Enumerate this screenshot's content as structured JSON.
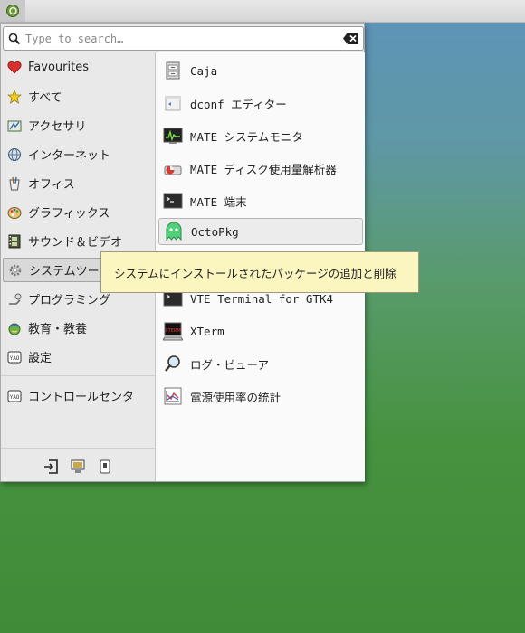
{
  "search": {
    "placeholder": "Type to search…"
  },
  "categories": [
    {
      "label": "Favourites",
      "icon": "heart-icon"
    },
    {
      "label": "すべて",
      "icon": "star-icon"
    },
    {
      "label": "アクセサリ",
      "icon": "accessories-icon"
    },
    {
      "label": "インターネット",
      "icon": "globe-icon"
    },
    {
      "label": "オフィス",
      "icon": "office-icon"
    },
    {
      "label": "グラフィックス",
      "icon": "palette-icon"
    },
    {
      "label": "サウンド＆ビデオ",
      "icon": "film-icon"
    },
    {
      "label": "システムツール",
      "icon": "gear-icon",
      "selected": true
    },
    {
      "label": "プログラミング",
      "icon": "programming-icon"
    },
    {
      "label": "教育・教養",
      "icon": "education-icon"
    },
    {
      "label": "設定",
      "icon": "settings-icon"
    },
    {
      "label": "コントロールセンタ",
      "icon": "control-center-icon"
    }
  ],
  "apps": [
    {
      "label": "Caja",
      "icon": "file-cabinet-icon"
    },
    {
      "label": "dconf エディター",
      "icon": "dconf-icon"
    },
    {
      "label": "MATE システムモニタ",
      "icon": "system-monitor-icon"
    },
    {
      "label": "MATE ディスク使用量解析器",
      "icon": "disk-usage-icon"
    },
    {
      "label": "MATE 端末",
      "icon": "terminal-icon"
    },
    {
      "label": "OctoPkg",
      "icon": "ghost-icon",
      "hovered": true
    },
    {
      "label": "VTE Terminal for GTK4",
      "icon": "terminal-icon"
    },
    {
      "label": "XTerm",
      "icon": "xterm-icon"
    },
    {
      "label": "ログ・ビューア",
      "icon": "magnifier-icon"
    },
    {
      "label": "電源使用率の統計",
      "icon": "power-stats-icon"
    }
  ],
  "tooltip": {
    "text": "システムにインストールされたパッケージの追加と削除"
  },
  "colors": {
    "accent_green": "#3f8b38",
    "tooltip_bg": "#fbf6c0"
  }
}
